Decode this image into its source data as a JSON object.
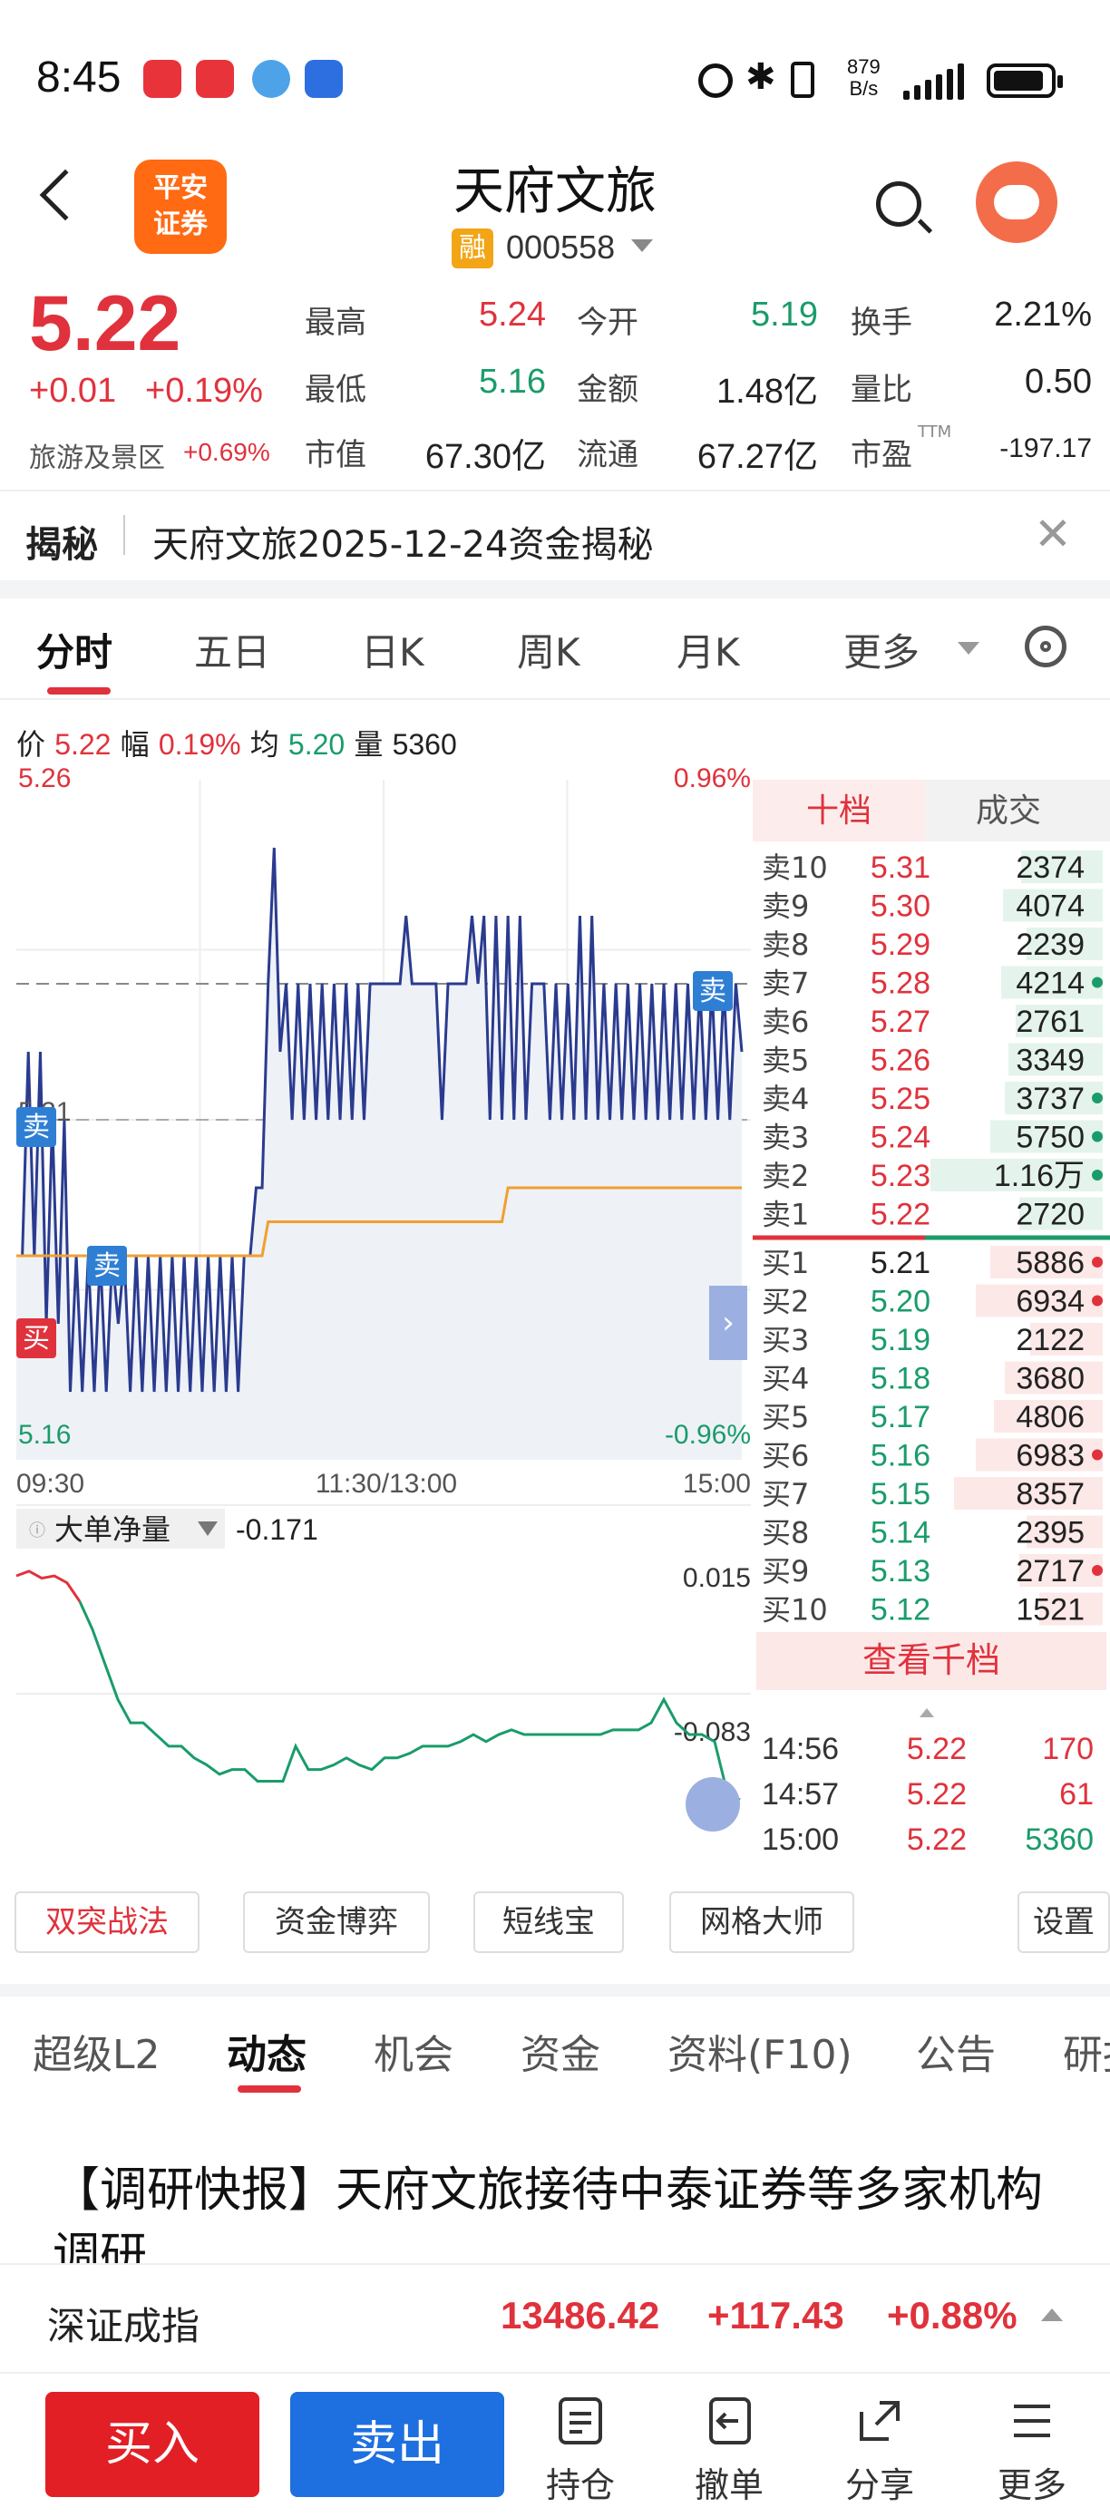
{
  "status": {
    "time": "8:45",
    "net_speed_top": "879",
    "net_speed_bottom": "B/s"
  },
  "header": {
    "broker_logo": [
      "平安",
      "证券"
    ],
    "title": "天府文旅",
    "badge": "融",
    "code": "000558"
  },
  "quote": {
    "price": "5.22",
    "change": "+0.01",
    "change_pct": "+0.19%",
    "sector": "旅游及景区",
    "sector_chg": "+0.69%",
    "rows": [
      [
        {
          "label": "最高",
          "value": "5.24",
          "color": "red"
        },
        {
          "label": "今开",
          "value": "5.19",
          "color": "green"
        },
        {
          "label": "换手",
          "value": "2.21%",
          "color": "black"
        }
      ],
      [
        {
          "label": "最低",
          "value": "5.16",
          "color": "green"
        },
        {
          "label": "金额",
          "value": "1.48亿",
          "color": "black"
        },
        {
          "label": "量比",
          "value": "0.50",
          "color": "black"
        }
      ],
      [
        {
          "label": "市值",
          "value": "67.30亿",
          "color": "black"
        },
        {
          "label": "流通",
          "value": "67.27亿",
          "color": "black"
        },
        {
          "label": "市盈",
          "value": "-197.17",
          "color": "black",
          "sup": "TTM"
        }
      ]
    ]
  },
  "reveal": {
    "label": "揭秘",
    "text": "天府文旅2025-12-24资金揭秘"
  },
  "chart_tabs": [
    "分时",
    "五日",
    "日K",
    "周K",
    "月K",
    "更多"
  ],
  "info_line": {
    "price_label": "价",
    "price": "5.22",
    "amp_label": "幅",
    "amp": "0.19%",
    "avg_label": "均",
    "avg": "5.20",
    "vol_label": "量",
    "vol": "5360"
  },
  "chart_data": {
    "type": "line",
    "title": "",
    "x_labels": [
      "09:30",
      "11:30/13:00",
      "15:00"
    ],
    "y_max_label": "5.26",
    "y_min_label": "5.16",
    "y_ref_label": "5.21",
    "pct_max_label": "0.96%",
    "pct_min_label": "-0.96%",
    "ylim": [
      5.16,
      5.26
    ],
    "series": [
      {
        "color": "#2a3b8f",
        "values": [
          5.19,
          5.19,
          5.22,
          5.19,
          5.22,
          5.18,
          5.21,
          5.18,
          5.21,
          5.17,
          5.19,
          5.17,
          5.19,
          5.17,
          5.19,
          5.17,
          5.19,
          5.18,
          5.19,
          5.17,
          5.19,
          5.17,
          5.19,
          5.17,
          5.19,
          5.17,
          5.19,
          5.17,
          5.19,
          5.17,
          5.19,
          5.17,
          5.19,
          5.17,
          5.19,
          5.17,
          5.19,
          5.17,
          5.19,
          5.19,
          5.2,
          5.2,
          5.23,
          5.25,
          5.22,
          5.23,
          5.21,
          5.23,
          5.21,
          5.23,
          5.21,
          5.23,
          5.21,
          5.23,
          5.21,
          5.23,
          5.21,
          5.23,
          5.21,
          5.23,
          5.23,
          5.23,
          5.23,
          5.23,
          5.23,
          5.24,
          5.23,
          5.23,
          5.23,
          5.23,
          5.23,
          5.21,
          5.23,
          5.23,
          5.23,
          5.23,
          5.24,
          5.23,
          5.24,
          5.21,
          5.24,
          5.21,
          5.24,
          5.21,
          5.24,
          5.21,
          5.23,
          5.23,
          5.23,
          5.21,
          5.23,
          5.21,
          5.23,
          5.21,
          5.24,
          5.21,
          5.24,
          5.21,
          5.23,
          5.21,
          5.23,
          5.21,
          5.23,
          5.21,
          5.23,
          5.21,
          5.23,
          5.21,
          5.23,
          5.21,
          5.23,
          5.21,
          5.23,
          5.21,
          5.23,
          5.21,
          5.23,
          5.21,
          5.23,
          5.21,
          5.23,
          5.22
        ]
      },
      {
        "color": "#f0a030",
        "values": [
          5.19,
          5.19,
          5.19,
          5.19,
          5.19,
          5.19,
          5.19,
          5.19,
          5.19,
          5.19,
          5.19,
          5.19,
          5.19,
          5.19,
          5.19,
          5.19,
          5.19,
          5.19,
          5.19,
          5.19,
          5.19,
          5.19,
          5.19,
          5.19,
          5.19,
          5.19,
          5.19,
          5.19,
          5.19,
          5.19,
          5.19,
          5.19,
          5.19,
          5.19,
          5.19,
          5.19,
          5.19,
          5.19,
          5.19,
          5.19,
          5.19,
          5.19,
          5.195,
          5.195,
          5.195,
          5.195,
          5.195,
          5.195,
          5.195,
          5.195,
          5.195,
          5.195,
          5.195,
          5.195,
          5.195,
          5.195,
          5.195,
          5.195,
          5.195,
          5.195,
          5.195,
          5.195,
          5.195,
          5.195,
          5.195,
          5.195,
          5.195,
          5.195,
          5.195,
          5.195,
          5.195,
          5.195,
          5.195,
          5.195,
          5.195,
          5.195,
          5.195,
          5.195,
          5.195,
          5.195,
          5.195,
          5.195,
          5.2,
          5.2,
          5.2,
          5.2,
          5.2,
          5.2,
          5.2,
          5.2,
          5.2,
          5.2,
          5.2,
          5.2,
          5.2,
          5.2,
          5.2,
          5.2,
          5.2,
          5.2,
          5.2,
          5.2,
          5.2,
          5.2,
          5.2,
          5.2,
          5.2,
          5.2,
          5.2,
          5.2,
          5.2,
          5.2,
          5.2,
          5.2,
          5.2,
          5.2,
          5.2,
          5.2,
          5.2,
          5.2,
          5.2,
          5.2
        ]
      }
    ],
    "markers": [
      {
        "label": "卖",
        "color": "#2e7fd4"
      },
      {
        "label": "卖",
        "color": "#2e7fd4"
      },
      {
        "label": "买",
        "color": "#e0323c"
      },
      {
        "label": "卖",
        "color": "#2e7fd4"
      }
    ]
  },
  "big_order": {
    "label": "大单净量",
    "value": "-0.171",
    "top_label": "0.015",
    "bottom_label": "-0.083"
  },
  "big_order_series": [
    0.013,
    0.015,
    0.012,
    0.013,
    0.01,
    0.002,
    -0.01,
    -0.025,
    -0.04,
    -0.05,
    -0.05,
    -0.055,
    -0.06,
    -0.06,
    -0.065,
    -0.068,
    -0.072,
    -0.07,
    -0.07,
    -0.075,
    -0.075,
    -0.075,
    -0.06,
    -0.07,
    -0.07,
    -0.068,
    -0.065,
    -0.068,
    -0.07,
    -0.065,
    -0.065,
    -0.063,
    -0.06,
    -0.06,
    -0.06,
    -0.058,
    -0.055,
    -0.058,
    -0.055,
    -0.053,
    -0.055,
    -0.055,
    -0.055,
    -0.055,
    -0.055,
    -0.055,
    -0.055,
    -0.053,
    -0.053,
    -0.053,
    -0.05,
    -0.04,
    -0.05,
    -0.055,
    -0.055,
    -0.058,
    -0.08,
    -0.083
  ],
  "depth": {
    "tabs": [
      "十档",
      "成交"
    ],
    "asks": [
      {
        "label": "卖10",
        "price": "5.31",
        "vol": "2374",
        "bar": 0.45,
        "dot": false
      },
      {
        "label": "卖9",
        "price": "5.30",
        "vol": "4074",
        "bar": 0.55,
        "dot": false
      },
      {
        "label": "卖8",
        "price": "5.29",
        "vol": "2239",
        "bar": 0.42,
        "dot": false
      },
      {
        "label": "卖7",
        "price": "5.28",
        "vol": "4214",
        "bar": 0.56,
        "dot": true
      },
      {
        "label": "卖6",
        "price": "5.27",
        "vol": "2761",
        "bar": 0.48,
        "dot": false
      },
      {
        "label": "卖5",
        "price": "5.26",
        "vol": "3349",
        "bar": 0.52,
        "dot": false
      },
      {
        "label": "卖4",
        "price": "5.25",
        "vol": "3737",
        "bar": 0.54,
        "dot": true
      },
      {
        "label": "卖3",
        "price": "5.24",
        "vol": "5750",
        "bar": 0.62,
        "dot": true
      },
      {
        "label": "卖2",
        "price": "5.23",
        "vol": "1.16万",
        "bar": 0.95,
        "dot": true
      },
      {
        "label": "卖1",
        "price": "5.22",
        "vol": "2720",
        "bar": 0.46,
        "dot": false
      }
    ],
    "bids": [
      {
        "label": "买1",
        "price": "5.21",
        "vol": "5886",
        "bar": 0.62,
        "dot": true
      },
      {
        "label": "买2",
        "price": "5.20",
        "vol": "6934",
        "bar": 0.7,
        "dot": true
      },
      {
        "label": "买3",
        "price": "5.19",
        "vol": "2122",
        "bar": 0.4,
        "dot": false
      },
      {
        "label": "买4",
        "price": "5.18",
        "vol": "3680",
        "bar": 0.54,
        "dot": false
      },
      {
        "label": "买5",
        "price": "5.17",
        "vol": "4806",
        "bar": 0.6,
        "dot": false
      },
      {
        "label": "买6",
        "price": "5.16",
        "vol": "6983",
        "bar": 0.7,
        "dot": true
      },
      {
        "label": "买7",
        "price": "5.15",
        "vol": "8357",
        "bar": 0.82,
        "dot": false
      },
      {
        "label": "买8",
        "price": "5.14",
        "vol": "2395",
        "bar": 0.42,
        "dot": false
      },
      {
        "label": "买9",
        "price": "5.13",
        "vol": "2717",
        "bar": 0.46,
        "dot": true
      },
      {
        "label": "买10",
        "price": "5.12",
        "vol": "1521",
        "bar": 0.35,
        "dot": false
      }
    ],
    "view_all": "查看千档",
    "trades": [
      {
        "time": "14:56",
        "price": "5.22",
        "vol": "170",
        "color": "red"
      },
      {
        "time": "14:57",
        "price": "5.22",
        "vol": "61",
        "color": "red"
      },
      {
        "time": "15:00",
        "price": "5.22",
        "vol": "5360",
        "color": "green"
      }
    ]
  },
  "tools": [
    "双突战法",
    "资金博弈",
    "短线宝",
    "网格大师",
    "设置"
  ],
  "bottom_tabs": [
    "超级L2",
    "动态",
    "机会",
    "资金",
    "资料(F10)",
    "公告",
    "研报"
  ],
  "news": {
    "title": "【调研快报】天府文旅接待中泰证券等多家机构调研"
  },
  "index": {
    "name": "深证成指",
    "value": "13486.42",
    "change": "+117.43",
    "pct": "+0.88%"
  },
  "actions": {
    "buy": "买入",
    "sell": "卖出",
    "items": [
      "持仓",
      "撤单",
      "分享",
      "更多"
    ]
  }
}
